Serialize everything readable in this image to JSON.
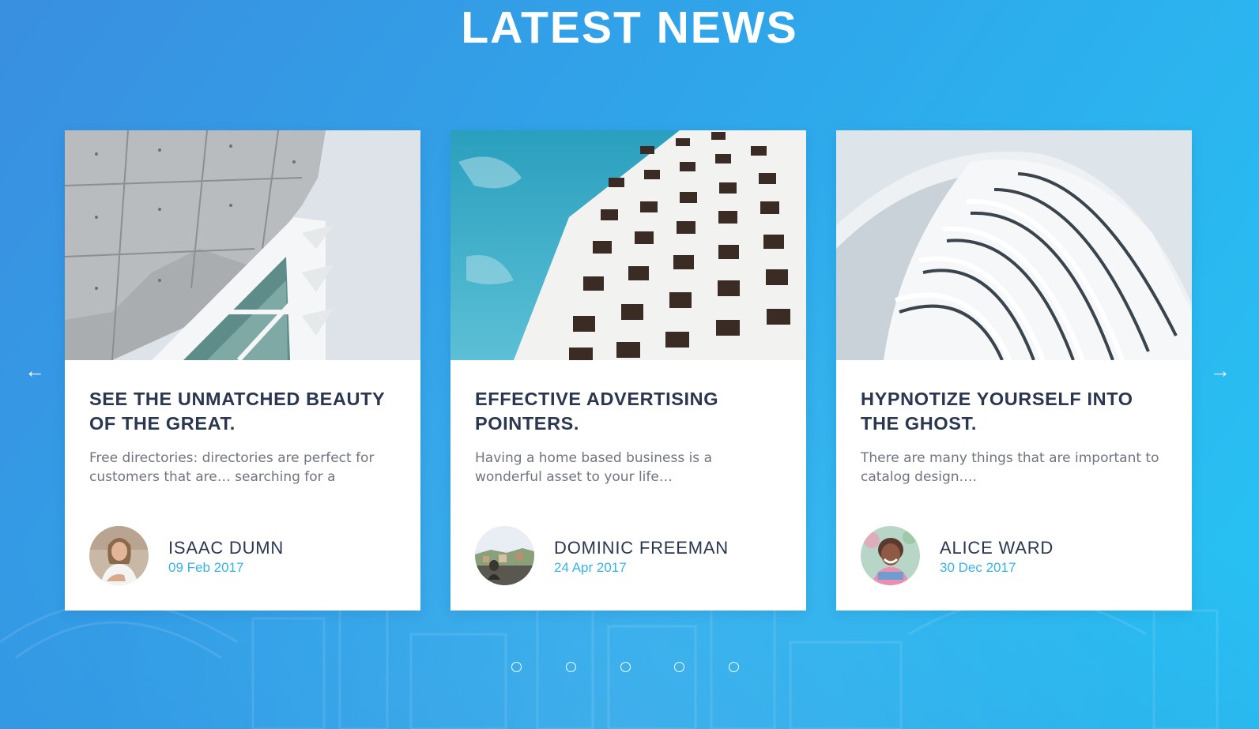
{
  "section": {
    "title": "LATEST NEWS"
  },
  "carousel": {
    "prev_icon": "←",
    "next_icon": "→",
    "dot_count": 5
  },
  "colors": {
    "title_text": "#2a374f",
    "accent_date": "#3bb0ea",
    "excerpt_text": "#6f7480",
    "bg_start": "#3a8fe0",
    "bg_end": "#27c4f4"
  },
  "cards": [
    {
      "image": "concrete-building-photo",
      "title": "SEE THE UNMATCHED BEAUTY OF THE GREAT.",
      "excerpt": "Free directories: directories are perfect for customers that are… searching for a",
      "author": "ISAAC DUMN",
      "date": "09 Feb 2017"
    },
    {
      "image": "white-tower-photo",
      "title": "EFFECTIVE ADVERTISING POINTERS.",
      "excerpt": "Having a home based business is a wonderful asset to your life…",
      "author": "DOMINIC FREEMAN",
      "date": "24 Apr 2017"
    },
    {
      "image": "curved-facade-photo",
      "title": "HYPNOTIZE YOURSELF INTO THE GHOST.",
      "excerpt": "There are many things that are important to catalog design….",
      "author": "ALICE WARD",
      "date": "30 Dec 2017"
    }
  ]
}
